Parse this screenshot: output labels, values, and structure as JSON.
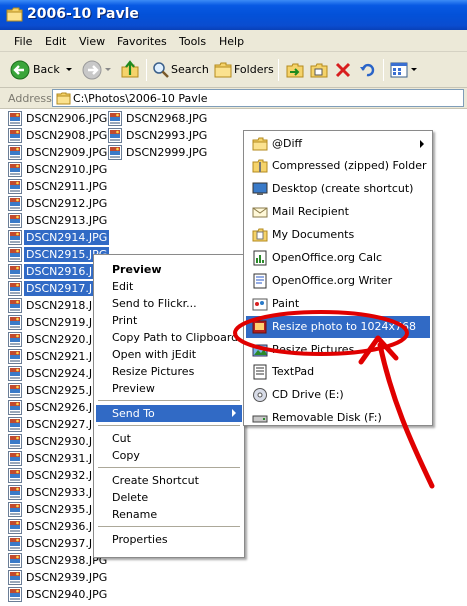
{
  "window": {
    "title": "2006-10 Pavle"
  },
  "menubar": [
    "File",
    "Edit",
    "View",
    "Favorites",
    "Tools",
    "Help"
  ],
  "toolbar": {
    "back": "Back",
    "search": "Search",
    "folders": "Folders"
  },
  "address": {
    "label": "Address",
    "path": "C:\\Photos\\2006-10 Pavle"
  },
  "files_col1": [
    {
      "name": "DSCN2906.JPG",
      "selected": false
    },
    {
      "name": "DSCN2908.JPG",
      "selected": false
    },
    {
      "name": "DSCN2909.JPG",
      "selected": false
    },
    {
      "name": "DSCN2910.JPG",
      "selected": false
    },
    {
      "name": "DSCN2911.JPG",
      "selected": false
    },
    {
      "name": "DSCN2912.JPG",
      "selected": false
    },
    {
      "name": "DSCN2913.JPG",
      "selected": false
    },
    {
      "name": "DSCN2914.JPG",
      "selected": true
    },
    {
      "name": "DSCN2915.JPG",
      "selected": true
    },
    {
      "name": "DSCN2916.JPG",
      "selected": true
    },
    {
      "name": "DSCN2917.JPG",
      "selected": true
    },
    {
      "name": "DSCN2918.JPG",
      "selected": false
    },
    {
      "name": "DSCN2919.JPG",
      "selected": false
    },
    {
      "name": "DSCN2920.JPG",
      "selected": false
    },
    {
      "name": "DSCN2921.JPG",
      "selected": false
    },
    {
      "name": "DSCN2924.JPG",
      "selected": false
    },
    {
      "name": "DSCN2925.JPG",
      "selected": false
    },
    {
      "name": "DSCN2926.JPG",
      "selected": false
    },
    {
      "name": "DSCN2927.JPG",
      "selected": false
    },
    {
      "name": "DSCN2930.JPG",
      "selected": false
    },
    {
      "name": "DSCN2931.JPG",
      "selected": false
    },
    {
      "name": "DSCN2932.JPG",
      "selected": false
    },
    {
      "name": "DSCN2933.JPG",
      "selected": false
    },
    {
      "name": "DSCN2935.JPG",
      "selected": false
    },
    {
      "name": "DSCN2936.JPG",
      "selected": false
    },
    {
      "name": "DSCN2937.JPG",
      "selected": false
    },
    {
      "name": "DSCN2938.JPG",
      "selected": false
    },
    {
      "name": "DSCN2939.JPG",
      "selected": false
    },
    {
      "name": "DSCN2940.JPG",
      "selected": false
    }
  ],
  "files_col2": [
    {
      "name": "DSCN2968.JPG",
      "selected": false
    },
    {
      "name": "DSCN2993.JPG",
      "selected": false
    },
    {
      "name": "DSCN2999.JPG",
      "selected": false
    }
  ],
  "context_menu": {
    "items": [
      {
        "label": "Preview",
        "bold": true
      },
      {
        "label": "Edit"
      },
      {
        "label": "Send to Flickr..."
      },
      {
        "label": "Print"
      },
      {
        "label": "Copy Path to Clipboard"
      },
      {
        "label": "Open with jEdit"
      },
      {
        "label": "Resize Pictures"
      },
      {
        "label": "Preview"
      },
      {
        "separator": true
      },
      {
        "label": "Send To",
        "submenu": true,
        "highlighted": true
      },
      {
        "separator": true
      },
      {
        "label": "Cut"
      },
      {
        "label": "Copy"
      },
      {
        "separator": true
      },
      {
        "label": "Create Shortcut"
      },
      {
        "label": "Delete"
      },
      {
        "label": "Rename"
      },
      {
        "separator": true
      },
      {
        "label": "Properties"
      }
    ]
  },
  "sendto_menu": {
    "items": [
      {
        "label": "@Diff",
        "icon": "folder-icon",
        "submenu": true
      },
      {
        "label": "Compressed (zipped) Folder",
        "icon": "zip-folder-icon"
      },
      {
        "label": "Desktop (create shortcut)",
        "icon": "desktop-icon"
      },
      {
        "label": "Mail Recipient",
        "icon": "mail-icon"
      },
      {
        "label": "My Documents",
        "icon": "my-documents-icon"
      },
      {
        "label": "OpenOffice.org Calc",
        "icon": "calc-icon"
      },
      {
        "label": "OpenOffice.org Writer",
        "icon": "writer-icon"
      },
      {
        "label": "Paint",
        "icon": "paint-icon"
      },
      {
        "label": "Resize photo to 1024x768",
        "icon": "resize-photo-icon",
        "highlighted": true
      },
      {
        "label": "Resize Pictures",
        "icon": "resize-pictures-icon"
      },
      {
        "label": "TextPad",
        "icon": "textpad-icon"
      },
      {
        "label": "CD Drive (E:)",
        "icon": "cd-drive-icon"
      },
      {
        "label": "Removable Disk (F:)",
        "icon": "removable-disk-icon"
      }
    ]
  },
  "annotation": {
    "color": "#e00000"
  },
  "colors": {
    "selection": "#316ac5",
    "titlebar": "#0351d8",
    "chrome": "#ece9d8"
  }
}
